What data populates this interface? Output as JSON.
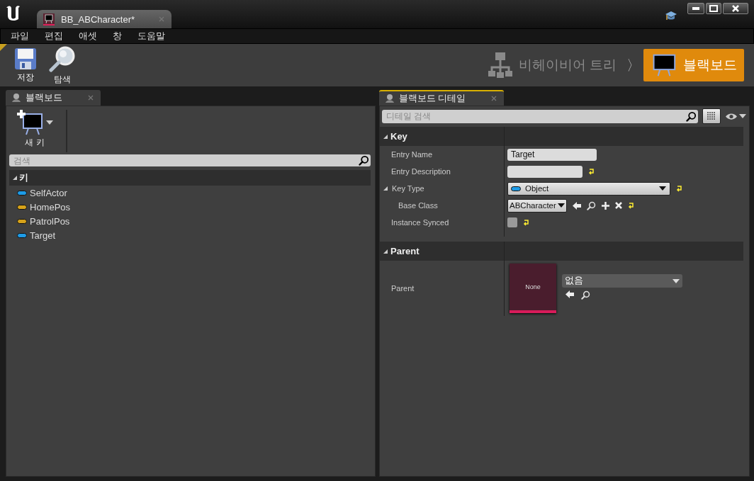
{
  "window": {
    "document_tab": {
      "title": "BB_ABCharacter*",
      "selected": true
    }
  },
  "menu": [
    "파일",
    "편집",
    "애셋",
    "창",
    "도움말"
  ],
  "toolbar": {
    "buttons": [
      {
        "kind": "save",
        "label": "저장"
      },
      {
        "kind": "browse",
        "label": "탐색"
      }
    ],
    "modes": [
      {
        "label": "비헤이비어 트리",
        "selected": false
      },
      {
        "label": "블랙보드",
        "selected": true
      }
    ],
    "separator": "〉"
  },
  "blackboard_panel": {
    "tab": "블랙보드",
    "new_key": "새 키",
    "search": {
      "placeholder": "검색"
    },
    "category": {
      "label": "키",
      "expanded": true
    },
    "keys": [
      {
        "name": "SelfActor",
        "color": "#1e9be6"
      },
      {
        "name": "HomePos",
        "color": "#d6a21a"
      },
      {
        "name": "PatrolPos",
        "color": "#d6a21a"
      },
      {
        "name": "Target",
        "color": "#1e9be6"
      }
    ]
  },
  "details_panel": {
    "tab": "블랙보드 디테일",
    "search": {
      "placeholder": "디테일 검색"
    },
    "sections": [
      {
        "title": "Key",
        "expanded": true,
        "rows": [
          {
            "kind": "text",
            "label": "Entry Name",
            "value": "Target",
            "reset": false
          },
          {
            "kind": "text",
            "label": "Entry Description",
            "reset": true
          },
          {
            "kind": "type",
            "label": "Key Type",
            "value": "Object",
            "expanded": true,
            "reset": true,
            "children": [
              {
                "kind": "class",
                "label": "Base Class",
                "value": "ABCharacter",
                "reset": true
              }
            ]
          },
          {
            "kind": "checkbox",
            "label": "Instance Synced",
            "checked": false,
            "reset": true
          }
        ]
      },
      {
        "title": "Parent",
        "expanded": true,
        "rows": [
          {
            "kind": "asset",
            "label": "Parent",
            "thumbnail": "None",
            "value": "없음",
            "reset": false
          }
        ]
      }
    ]
  }
}
